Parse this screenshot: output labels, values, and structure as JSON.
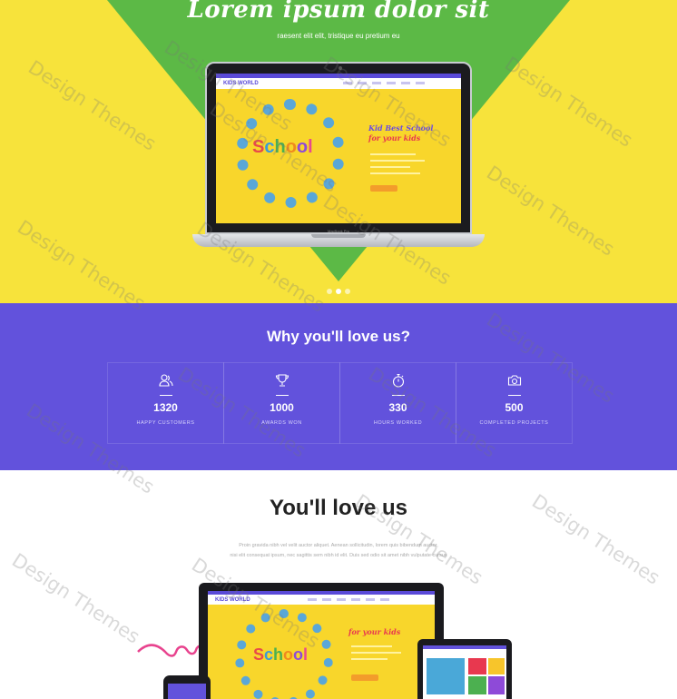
{
  "hero": {
    "title": "Lorem ipsum dolor sit",
    "subtitle": "raesent elit elit, tristique eu pretium eu",
    "colors": {
      "background": "#f7e33b",
      "triangle": "#5cb946"
    },
    "laptop": {
      "brand_label": "MacBook Pro",
      "screen": {
        "logo": "KIDS WORLD",
        "heading_line1": "Kid Best School",
        "heading_line2": "for your kids",
        "illustration_word": [
          "S",
          "c",
          "h",
          "o",
          "o",
          "l"
        ]
      }
    },
    "carousel_dots": 3,
    "carousel_active": 2
  },
  "stats": {
    "title": "Why you'll love us?",
    "background": "#6252dc",
    "items": [
      {
        "icon": "users-icon",
        "value": "1320",
        "label": "HAPPY CUSTOMERS"
      },
      {
        "icon": "trophy-icon",
        "value": "1000",
        "label": "AWARDS WON"
      },
      {
        "icon": "stopwatch-icon",
        "value": "330",
        "label": "HOURS WORKED"
      },
      {
        "icon": "camera-icon",
        "value": "500",
        "label": "COMPLETED PROJECTS"
      }
    ]
  },
  "love": {
    "title": "You'll love us",
    "text_line1": "Proin gravida nibh vel velit auctor aliquet. Aenean sollicitudin, lorem quis bibendum auctor,",
    "text_line2": "nisi elit consequat ipsum, nec sagittis sem nibh id elit. Duis sed odio sit amet nibh vulputate cursus",
    "devices": {
      "monitor_logo": "KIDS WORLD",
      "monitor_heading": "for your kids",
      "monitor_word": [
        "S",
        "c",
        "h",
        "o",
        "o",
        "l"
      ]
    }
  },
  "watermark": "Design Themes"
}
